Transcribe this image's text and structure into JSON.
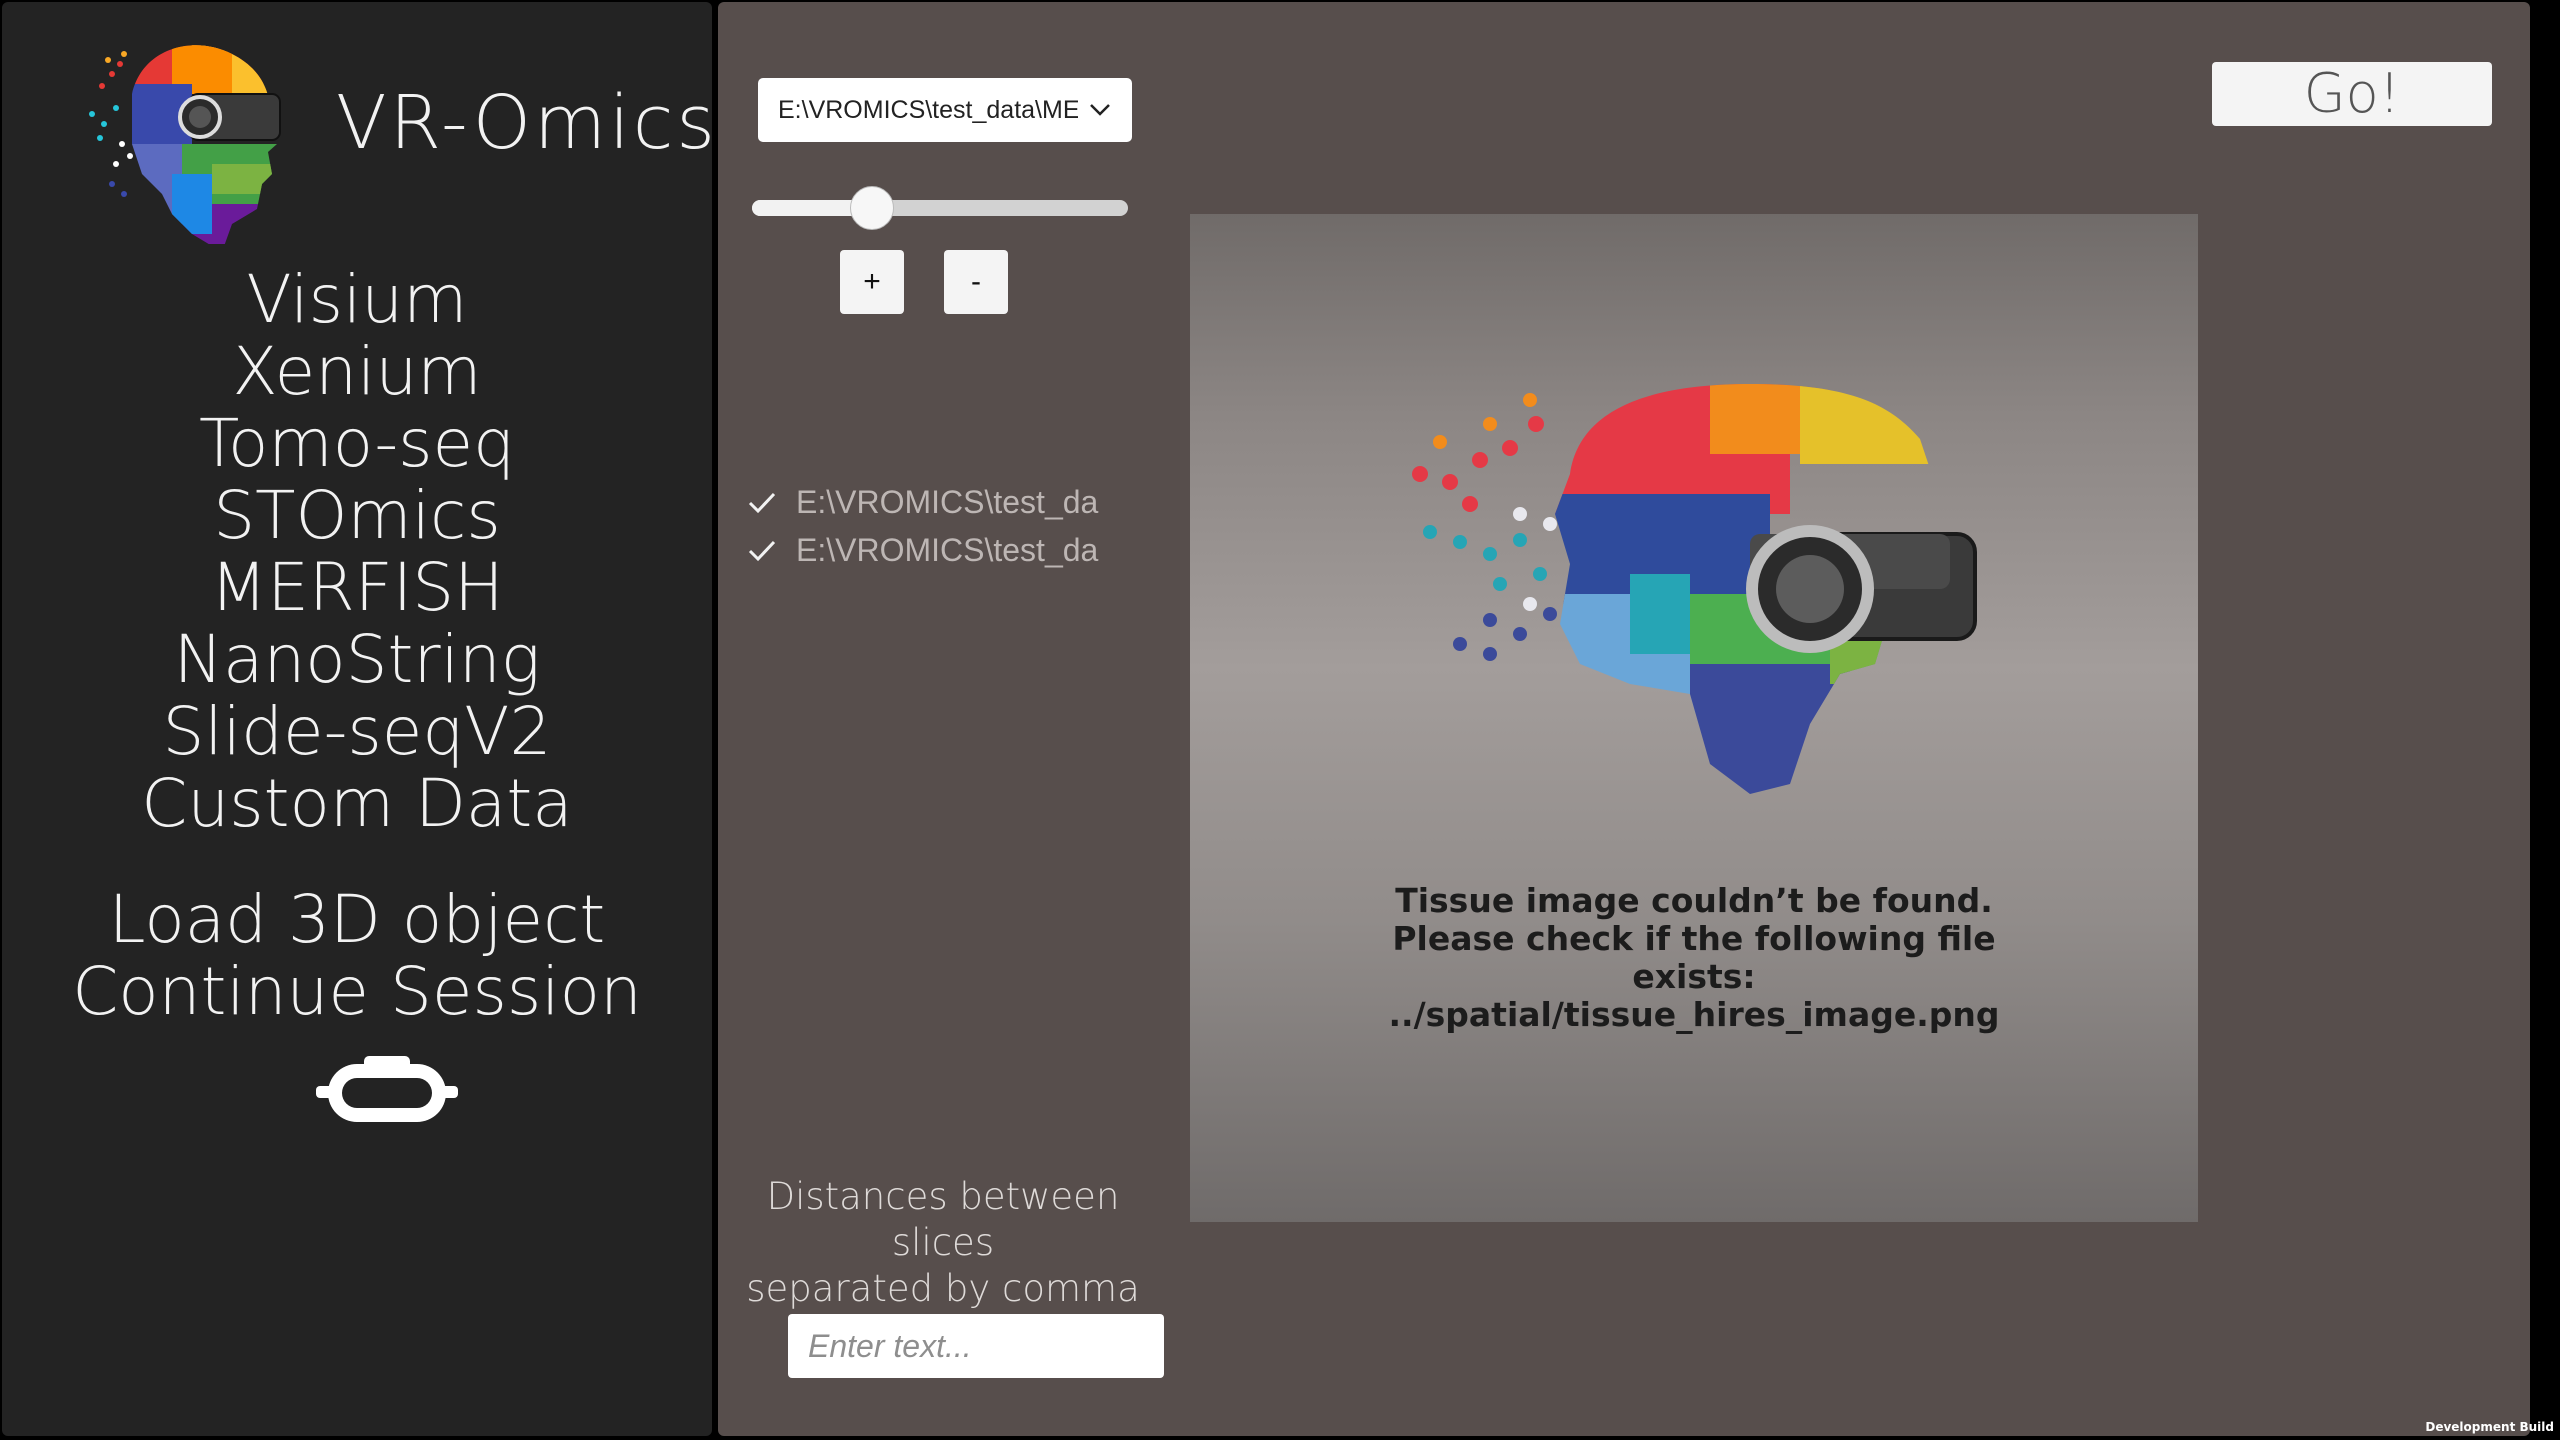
{
  "sidebar": {
    "app_title": "VR-Omics",
    "logo_icon": "vr-omics-logo",
    "technologies": [
      {
        "label": "Visium"
      },
      {
        "label": "Xenium"
      },
      {
        "label": "Tomo-seq"
      },
      {
        "label": "STOmics"
      },
      {
        "label": "MERFISH"
      },
      {
        "label": "NanoString"
      },
      {
        "label": "Slide-seqV2"
      },
      {
        "label": "Custom Data"
      }
    ],
    "actions": [
      {
        "label": "Load 3D object"
      },
      {
        "label": "Continue Session"
      }
    ],
    "vr_icon": "vr-headset-icon"
  },
  "main": {
    "dataset_select": {
      "value": "E:\\VROMICS\\test_data\\ME"
    },
    "slider": {
      "value": 0.32
    },
    "plus_label": "+",
    "minus_label": "-",
    "files": [
      {
        "label": "E:\\VROMICS\\test_da",
        "checked": true
      },
      {
        "label": "E:\\VROMICS\\test_da",
        "checked": true
      }
    ],
    "image_error": {
      "line1": "Tissue image couldn’t be found.",
      "line2": "Please check if the following file",
      "line3": "exists:",
      "line4": "../spatial/tissue_hires_image.png"
    },
    "go_label": "Go!",
    "distances_label_line1": "Distances between slices",
    "distances_label_line2": "separated by comma",
    "distances_input": {
      "value": "",
      "placeholder": "Enter text..."
    }
  },
  "footer": {
    "build_label": "Development Build"
  },
  "colors": {
    "sidebar_bg": "#232323",
    "main_bg": "#574e4c",
    "text_light": "#f2f2f2"
  }
}
